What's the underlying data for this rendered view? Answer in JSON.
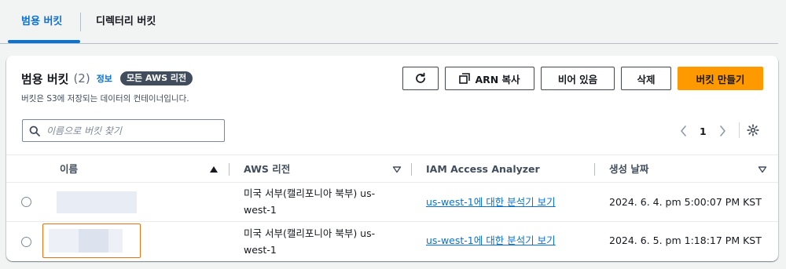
{
  "tabs": [
    {
      "label": "범용 버킷",
      "active": true
    },
    {
      "label": "디렉터리 버킷",
      "active": false
    }
  ],
  "panel": {
    "title": "범용 버킷",
    "count": "(2)",
    "info_label": "정보",
    "region_badge": "모든 AWS 리전",
    "description": "버킷은 S3에 저장되는 데이터의 컨테이너입니다."
  },
  "actions": {
    "refresh_icon": "refresh-icon",
    "copy_arn": "ARN 복사",
    "empty": "비어 있음",
    "delete": "삭제",
    "create": "버킷 만들기"
  },
  "search": {
    "placeholder": "이름으로 버킷 찾기",
    "value": ""
  },
  "pagination": {
    "current_page": "1"
  },
  "table": {
    "columns": [
      "이름",
      "AWS 리전",
      "IAM Access Analyzer",
      "생성 날짜"
    ],
    "rows": [
      {
        "name": "",
        "region": "미국 서부(캘리포니아 북부) us-west-1",
        "analyzer_link": "us-west-1에 대한 분석기 보기",
        "created": "2024. 6. 4. pm 5:00:07 PM KST"
      },
      {
        "name": "",
        "region": "미국 서부(캘리포니아 북부) us-west-1",
        "analyzer_link": "us-west-1에 대한 분석기 보기",
        "created": "2024. 6. 5. pm 1:18:17 PM KST"
      }
    ]
  },
  "colors": {
    "accent": "#0972d3",
    "primary_button": "#ff9900",
    "badge_bg": "#414d5c",
    "highlight_box": "#ec7211"
  }
}
